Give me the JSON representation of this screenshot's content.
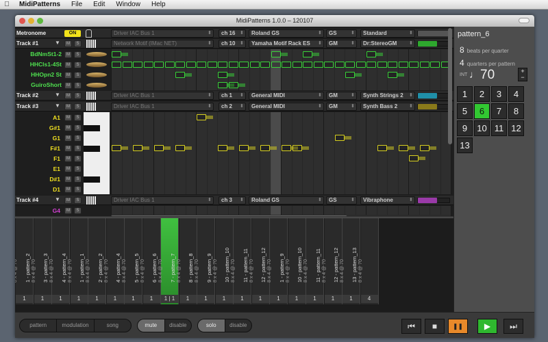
{
  "menu": {
    "app": "MidiPatterns",
    "items": [
      "File",
      "Edit",
      "Window",
      "Help"
    ]
  },
  "window": {
    "title": "MidiPatterns 1.0.0 – 120107"
  },
  "metronome": {
    "label": "Metronome",
    "toggle": "ON",
    "driver": "Driver IAC Bus 1",
    "channel": "ch 16",
    "device": "Roland GS",
    "mode": "GS",
    "program": "Standard"
  },
  "tracks": [
    {
      "name": "Track #1",
      "driver": "Network Motif (IMac NET)",
      "channel": "ch 10",
      "device": "Yamaha Motif Rack ES",
      "mode": "GM",
      "program": "Dr:StereoGM",
      "meter_color": "#2ea82e",
      "lanes": [
        "BdNmSt1-2",
        "HHCls1-4St",
        "HHOpn2 St",
        "GuiroShort"
      ]
    },
    {
      "name": "Track #2",
      "driver": "Driver IAC Bus 1",
      "channel": "ch 1",
      "device": "General MIDI",
      "mode": "GM",
      "program": "Synth Strings 2",
      "meter_color": "#1f8fa8"
    },
    {
      "name": "Track #3",
      "driver": "Driver IAC Bus 1",
      "channel": "ch 2",
      "device": "General MIDI",
      "mode": "GM",
      "program": "Synth Bass 2",
      "meter_color": "#8a7a1a",
      "lanes": [
        "A1",
        "G#1",
        "G1",
        "F#1",
        "F1",
        "E1",
        "D#1",
        "D1"
      ]
    },
    {
      "name": "Track #4",
      "driver": "Driver IAC Bus 1",
      "channel": "ch 3",
      "device": "Roland GS",
      "mode": "GS",
      "program": "Vibraphone",
      "meter_color": "#9a3aa8",
      "lanes": [
        "G4"
      ]
    }
  ],
  "mute_solo": {
    "m": "M",
    "s": "S"
  },
  "side": {
    "pattern_name": "pattern_6",
    "beats": "8",
    "beats_label": "beats per quarter",
    "quarters": "4",
    "quarters_label": "quarters per pattern",
    "int_label": "INT",
    "note_glyph": "♩",
    "tempo": "70",
    "plus": "+",
    "minus": "−",
    "buttons": [
      "1",
      "2",
      "3",
      "4",
      "5",
      "6",
      "7",
      "8",
      "9",
      "10",
      "11",
      "12",
      "13"
    ],
    "selected": "6"
  },
  "patterns": [
    {
      "name": "1 - pattern_1",
      "meta": "8 x 4 @ 70",
      "count": "1"
    },
    {
      "name": "1 - pattern_2",
      "meta": "8 x 4 @ 70",
      "count": "1"
    },
    {
      "name": "3 - pattern_3",
      "meta": "8 x 4 @ 70",
      "count": "1"
    },
    {
      "name": "4 - pattern_4",
      "meta": "8 x 4 @ 70",
      "count": "1"
    },
    {
      "name": "1 - pattern_1",
      "meta": "8 x 4 @ 70",
      "count": "1"
    },
    {
      "name": "2 - pattern_2",
      "meta": "8 x 4 @ 70",
      "count": "1"
    },
    {
      "name": "4 - pattern_4",
      "meta": "8 x 4 @ 70",
      "count": "1"
    },
    {
      "name": "5 - pattern_5",
      "meta": "8 x 4 @ 70",
      "count": "1"
    },
    {
      "name": "6 - pattern_6",
      "meta": "8 x 4 @ 70",
      "count": "1 | 1"
    },
    {
      "name": "7 - pattern_7",
      "meta": "8 x 4 @ 70",
      "count": "1"
    },
    {
      "name": "8 - pattern_8",
      "meta": "8 x 4 @ 70",
      "count": "1"
    },
    {
      "name": "9 - pattern_9",
      "meta": "8 x 4 @ 70",
      "count": "1"
    },
    {
      "name": "10 - pattern_10",
      "meta": "8 x 4 @ 70",
      "count": "1"
    },
    {
      "name": "11 - pattern_11",
      "meta": "8 x 4 @ 70",
      "count": "1"
    },
    {
      "name": "12 - pattern_12",
      "meta": "8 x 4 @ 70",
      "count": "1"
    },
    {
      "name": "1 - pattern_9",
      "meta": "8 x 4 @ 70",
      "count": "1"
    },
    {
      "name": "10 - pattern_10",
      "meta": "8 x 4 @ 70",
      "count": "1"
    },
    {
      "name": "11 - pattern_11",
      "meta": "8 x 4 @ 70",
      "count": "1"
    },
    {
      "name": "12 - pattern_12",
      "meta": "8 x 4 @ 70",
      "count": "1"
    },
    {
      "name": "13 - pattern_13",
      "meta": "8 x 4 @ 70",
      "count": "4"
    }
  ],
  "selected_pattern_index": 8,
  "bottom": {
    "modes": [
      "pattern",
      "modulation",
      "song"
    ],
    "mute": "mute",
    "mute_disable": "disable",
    "solo": "solo",
    "solo_disable": "disable"
  },
  "transport": {
    "prev": "⏮",
    "stop": "■",
    "pause": "❚❚",
    "play": "▶",
    "next": "⏭"
  },
  "colors": {
    "accent_green": "#32c832",
    "note_green": "#3ad43a",
    "note_yellow": "#d8d020",
    "lane_green": "#4fe04f",
    "lane_magenta": "#d040d0"
  }
}
